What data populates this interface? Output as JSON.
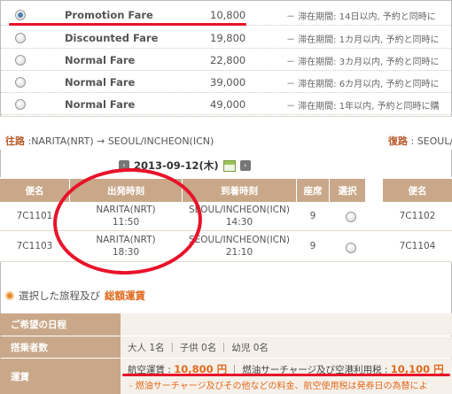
{
  "fares": [
    {
      "name": "Promotion Fare",
      "price": "10,800",
      "note": "－ 滞在期間: 14日以内, 予約と同時に",
      "selected": true
    },
    {
      "name": "Discounted Fare",
      "price": "19,800",
      "note": "－ 滞在期間: 1カ月以内, 予約と同時に",
      "selected": false
    },
    {
      "name": "Normal Fare",
      "price": "22,800",
      "note": "－ 滞在期間: 3カ月以内, 予約と同時に",
      "selected": false
    },
    {
      "name": "Normal Fare",
      "price": "39,000",
      "note": "－ 滞在期間: 6カ月以内, 予約と同時に",
      "selected": false
    },
    {
      "name": "Normal Fare",
      "price": "49,000",
      "note": "－ 滞在期間: 1年以内, 予約と同時に購",
      "selected": false
    }
  ],
  "route": {
    "outbound_prefix": "往路",
    "outbound": " :NARITA(NRT) → SEOUL/INCHEON(ICN)",
    "return_prefix": "復路",
    "return": " : SEOUL/"
  },
  "date": {
    "prev": "‹",
    "value": "2013-09-12(木)",
    "next": "›"
  },
  "table": {
    "headers": [
      "便名",
      "出発時刻",
      "到着時刻",
      "座席",
      "選択",
      "便名"
    ],
    "rows": [
      {
        "flight": "7C1101",
        "dep_place": "NARITA(NRT)",
        "dep_time": "11:50",
        "arr_place": "SEOUL/INCHEON(ICN)",
        "arr_time": "14:30",
        "seats": "9",
        "ret_flight": "7C1102"
      },
      {
        "flight": "7C1103",
        "dep_place": "NARITA(NRT)",
        "dep_time": "18:30",
        "arr_place": "SEOUL/INCHEON(ICN)",
        "arr_time": "21:10",
        "seats": "9",
        "ret_flight": "7C1104"
      }
    ]
  },
  "summary": {
    "title_prefix": "選択した旅程及び",
    "title_highlight": "総額運賃",
    "rows": [
      {
        "label": "ご希望の日程",
        "value": ""
      },
      {
        "label": "搭乗者数",
        "value": "大人 1名 ｜ 子供 0名 ｜ 幼児 0名"
      },
      {
        "label": "運賃",
        "value": ""
      }
    ],
    "air_fare_label": "航空運賃 : ",
    "air_fare_amount": "10,800 円",
    "separator": "｜",
    "surcharge_label": "燃油サーチャージ及び空港利用税 : ",
    "surcharge_amount": "10,100 円",
    "warning": "- 燃油サーチャージ及びその他などの料金、航空使用税は発券日の為替によ"
  },
  "colors": {
    "header_brown": "#c9a88a",
    "accent_orange": "#e06a1e",
    "annotation_red": "#e8132a"
  }
}
